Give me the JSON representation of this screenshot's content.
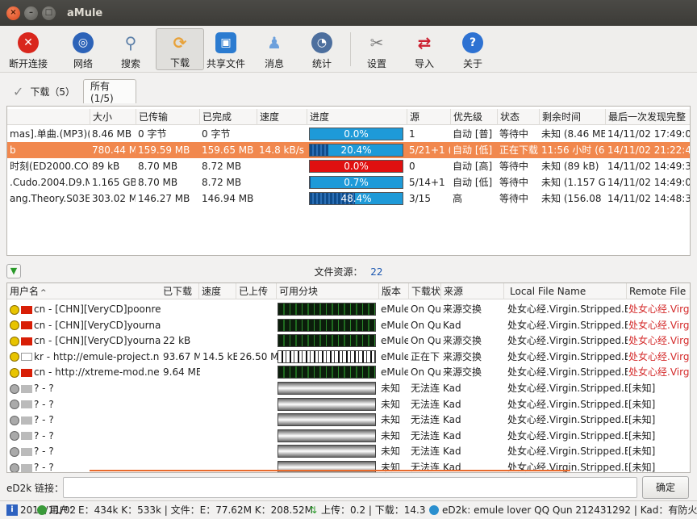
{
  "window": {
    "title": "aMule"
  },
  "toolbar": {
    "items": [
      {
        "label": "断开连接",
        "icon": "disconnect-icon",
        "color": "#d9261c"
      },
      {
        "label": "网络",
        "icon": "globe-icon",
        "color": "#2d63b8"
      },
      {
        "label": "搜索",
        "icon": "magnifier-icon",
        "color": "#8fa8c4"
      },
      {
        "label": "下载",
        "icon": "transfer-arrows-icon",
        "color": "#e8a23a"
      },
      {
        "label": "共享文件",
        "icon": "shared-box-icon",
        "color": "#2b7bd0"
      },
      {
        "label": "消息",
        "icon": "user-icon",
        "color": "#6ca0dc"
      },
      {
        "label": "统计",
        "icon": "gauge-icon",
        "color": "#4d6f9e"
      },
      {
        "label": "设置",
        "icon": "tools-icon",
        "color": "#7b7b7b"
      },
      {
        "label": "导入",
        "icon": "import-arrows-icon",
        "color": "#cc2030"
      },
      {
        "label": "关于",
        "icon": "help-icon",
        "color": "#2e72d2"
      }
    ]
  },
  "tabs": {
    "downloads": "下载（5）",
    "all": "所有 (1/5)"
  },
  "downloads": {
    "columns": [
      "大小",
      "已传输",
      "已完成",
      "速度",
      "进度",
      "源",
      "优先级",
      "状态",
      "剩余时间",
      "最后一次发现完整"
    ],
    "rows": [
      {
        "name": "mas].单曲.(MP3)(E",
        "size": "8.46 MB",
        "transferred": "0 字节",
        "completed": "0 字节",
        "speed": "",
        "progress": 0.0,
        "progress_label": "0.0%",
        "sources": "1",
        "priority": "自动 [普]",
        "status": "等待中",
        "remaining": "未知 (8.46 MB",
        "last_complete": "14/11/02 17:49:09",
        "bar_color": "#1e9ad8"
      },
      {
        "name": "b",
        "size": "780.44 MB",
        "transferred": "159.59 MB",
        "completed": "159.65 MB",
        "speed": "14.8 kB/s",
        "progress": 0.204,
        "progress_label": "20.4%",
        "sources": "5/21+1 (",
        "priority": "自动 [低]",
        "status": "正在下载",
        "remaining": "11:56 小时 (62",
        "last_complete": "14/11/02 21:22:43",
        "bar_color": "#1e9ad8"
      },
      {
        "name": "时刻(ED2000.COM",
        "size": "89 kB",
        "transferred": "8.70 MB",
        "completed": "8.72 MB",
        "speed": "",
        "progress": 0.0,
        "progress_label": "0.0%",
        "sources": "0",
        "priority": "自动 [高]",
        "status": "等待中",
        "remaining": "未知 (89 kB)",
        "last_complete": "14/11/02 14:49:31",
        "bar_color": "#e01010"
      },
      {
        "name": ".Cudo.2004.D9.Mi",
        "size": "1.165 GB",
        "transferred": "8.70 MB",
        "completed": "8.72 MB",
        "speed": "",
        "progress": 0.007,
        "progress_label": "0.7%",
        "sources": "5/14+1",
        "priority": "自动 [低]",
        "status": "等待中",
        "remaining": "未知 (1.157 G",
        "last_complete": "14/11/02 14:49:00",
        "bar_color": "#1e9ad8"
      },
      {
        "name": "ang.Theory.S03E2",
        "size": "303.02 MI",
        "transferred": "146.27 MB",
        "completed": "146.94 MB",
        "speed": "",
        "progress": 0.484,
        "progress_label": "48.4%",
        "sources": "3/15",
        "priority": "高",
        "status": "等待中",
        "remaining": "未知 (156.08 M",
        "last_complete": "14/11/02 14:48:39",
        "bar_color": "#1e9ad8"
      }
    ]
  },
  "sources_bar": {
    "label": "文件资源：",
    "count": "22"
  },
  "sources": {
    "columns": [
      "用户名",
      "已下载",
      "速度",
      "已上传",
      "可用分块",
      "版本",
      "下载状",
      "来源",
      "Local File Name",
      "Remote File N"
    ],
    "rows": [
      {
        "flag": "cn",
        "user": "cn - [CHN][VeryCD]poonrer",
        "downloaded": "",
        "speed": "",
        "uploaded": "",
        "version": "eMule",
        "state": "On Qu",
        "origin": "来源交换",
        "local": "处女心经.Virgin.Stripped.E",
        "remote": "处女心经.Virg",
        "chunk": "green"
      },
      {
        "flag": "cn",
        "user": "cn - [CHN][VeryCD]yournan",
        "downloaded": "",
        "speed": "",
        "uploaded": "",
        "version": "eMule",
        "state": "On Qu",
        "origin": "Kad",
        "local": "处女心经.Virgin.Stripped.E",
        "remote": "处女心经.Virg",
        "chunk": "green"
      },
      {
        "flag": "cn",
        "user": "cn - [CHN][VeryCD]yournan",
        "downloaded": "22 kB",
        "speed": "",
        "uploaded": "",
        "version": "eMule",
        "state": "On Qu",
        "origin": "来源交换",
        "local": "处女心经.Virgin.Stripped.E",
        "remote": "处女心经.Virg",
        "chunk": "green"
      },
      {
        "flag": "kr",
        "user": "kr - http://emule-project.n",
        "downloaded": "93.67 MI",
        "speed": "14.5 kB/",
        "uploaded": "26.50 MI",
        "version": "eMule",
        "state": "正在下",
        "origin": "来源交换",
        "local": "处女心经.Virgin.Stripped.E",
        "remote": "处女心经.Virg",
        "chunk": "white"
      },
      {
        "flag": "cn",
        "user": "cn - http://xtreme-mod.ne",
        "downloaded": "9.64 MB",
        "speed": "",
        "uploaded": "",
        "version": "eMule",
        "state": "On Qu",
        "origin": "来源交换",
        "local": "处女心经.Virgin.Stripped.E",
        "remote": "处女心经.Virg",
        "chunk": "green"
      },
      {
        "flag": "unk",
        "user": "? - ?",
        "downloaded": "",
        "speed": "",
        "uploaded": "",
        "version": "未知",
        "state": "无法连",
        "origin": "Kad",
        "local": "处女心经.Virgin.Stripped.E",
        "remote": "[未知]",
        "chunk": "grey"
      },
      {
        "flag": "unk",
        "user": "? - ?",
        "downloaded": "",
        "speed": "",
        "uploaded": "",
        "version": "未知",
        "state": "无法连",
        "origin": "Kad",
        "local": "处女心经.Virgin.Stripped.E",
        "remote": "[未知]",
        "chunk": "grey"
      },
      {
        "flag": "unk",
        "user": "? - ?",
        "downloaded": "",
        "speed": "",
        "uploaded": "",
        "version": "未知",
        "state": "无法连",
        "origin": "Kad",
        "local": "处女心经.Virgin.Stripped.E",
        "remote": "[未知]",
        "chunk": "grey"
      },
      {
        "flag": "unk",
        "user": "? - ?",
        "downloaded": "",
        "speed": "",
        "uploaded": "",
        "version": "未知",
        "state": "无法连",
        "origin": "Kad",
        "local": "处女心经.Virgin.Stripped.E",
        "remote": "[未知]",
        "chunk": "grey"
      },
      {
        "flag": "unk",
        "user": "? - ?",
        "downloaded": "",
        "speed": "",
        "uploaded": "",
        "version": "未知",
        "state": "无法连",
        "origin": "Kad",
        "local": "处女心经.Virgin.Stripped.E",
        "remote": "[未知]",
        "chunk": "grey"
      },
      {
        "flag": "unk",
        "user": "? - ?",
        "downloaded": "",
        "speed": "",
        "uploaded": "",
        "version": "未知",
        "state": "无法连",
        "origin": "Kad",
        "local": "处女心经.Virgin.Stripped.E",
        "remote": "[未知]",
        "chunk": "grey"
      }
    ]
  },
  "ed2k": {
    "label": "eD2k 链接：",
    "value": "",
    "confirm": "确定"
  },
  "statusbar": {
    "log": "2014/11/02",
    "users": "用户：E：434k K：533k | 文件：E：77.62M K：208.52M",
    "transfer": "上传：0.2 | 下载：14.3",
    "network": "eD2k: emule lover QQ Qun 212431292 | Kad：有防火墙"
  },
  "colors": {
    "selection": "#f1884e",
    "remote_text": "#d42a2a",
    "progress_red": "#e01010",
    "progress_blue": "#1e9ad8"
  }
}
